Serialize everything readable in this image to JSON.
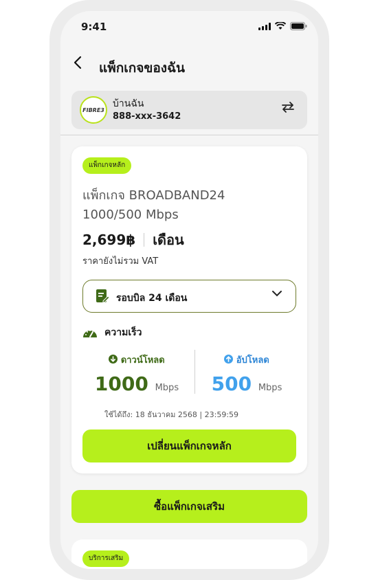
{
  "status": {
    "time": "9:41"
  },
  "header": {
    "title": "แพ็กเกจของฉัน"
  },
  "account": {
    "name": "บ้านฉัน",
    "number": "888-xxx-3642",
    "logo_text": "FIBRE3"
  },
  "package": {
    "badge": "แพ็กเกจหลัก",
    "name_line1": "แพ็กเกจ BROADBAND24",
    "name_line2": "1000/500 Mbps",
    "price": "2,699฿",
    "period": "เดือน",
    "vat_note": "ราคายังไม่รวม VAT",
    "billing_cycle": "รอบบิล 24 เดือน",
    "speed_heading": "ความเร็ว",
    "download_label": "ดาวน์โหลด",
    "download_value": "1000",
    "upload_label": "อัปโหลด",
    "upload_value": "500",
    "unit": "Mbps",
    "valid_until": "ใช้ได้ถึง: 18 ธันวาคม 2568 | 23:59:59",
    "change_button": "เปลี่ยนแพ็กเกจหลัก"
  },
  "extra_button": "ซื้อแพ็กเกจเสริม",
  "addon": {
    "badge": "บริการเสริม"
  },
  "colors": {
    "accent": "#b6ef1c",
    "download": "#3f6a17",
    "upload": "#41a1ec"
  },
  "icons": [
    "signal-icon",
    "wifi-icon",
    "battery-icon",
    "back-arrow-icon",
    "swap-icon",
    "bill-icon",
    "chevron-down-icon",
    "gauge-icon",
    "download-icon",
    "upload-icon"
  ]
}
